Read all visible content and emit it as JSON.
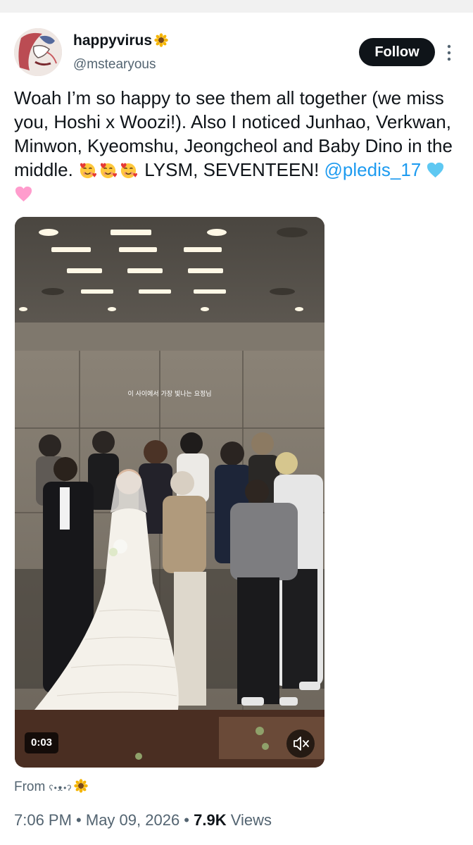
{
  "author": {
    "display_name": "happyvirus",
    "handle": "@mstearyous"
  },
  "follow_label": "Follow",
  "tweet": {
    "text": "Woah I’m so happy to see them all together (we miss you, Hoshi x Woozi!). Also I noticed Junhao, Verkwan, Minwon, Kyeomshu, Jeongcheol and Baby Dino in the middle. ",
    "text_after_emojis": " LYSM, SEVENTEEN! ",
    "mention": "@pledis_17"
  },
  "media": {
    "caption": "이 사이에서 가장 빛나는 요정님",
    "duration": "0:03"
  },
  "source": {
    "label": "From",
    "name": "ʕ•ᴥ•ʔ"
  },
  "meta": {
    "time": "7:06 PM",
    "separator": " • ",
    "date": "May 09, 2026",
    "views_count": "7.9K",
    "views_label": " Views"
  },
  "colors": {
    "accent": "#1d9bf0",
    "text": "#0f1419",
    "muted": "#536471",
    "follow_bg": "#0f1419"
  },
  "icons": [
    "sunflower-icon",
    "more-options-icon",
    "smiling-face-hearts-emoji",
    "light-blue-heart-emoji",
    "pink-heart-emoji",
    "mute-icon"
  ]
}
